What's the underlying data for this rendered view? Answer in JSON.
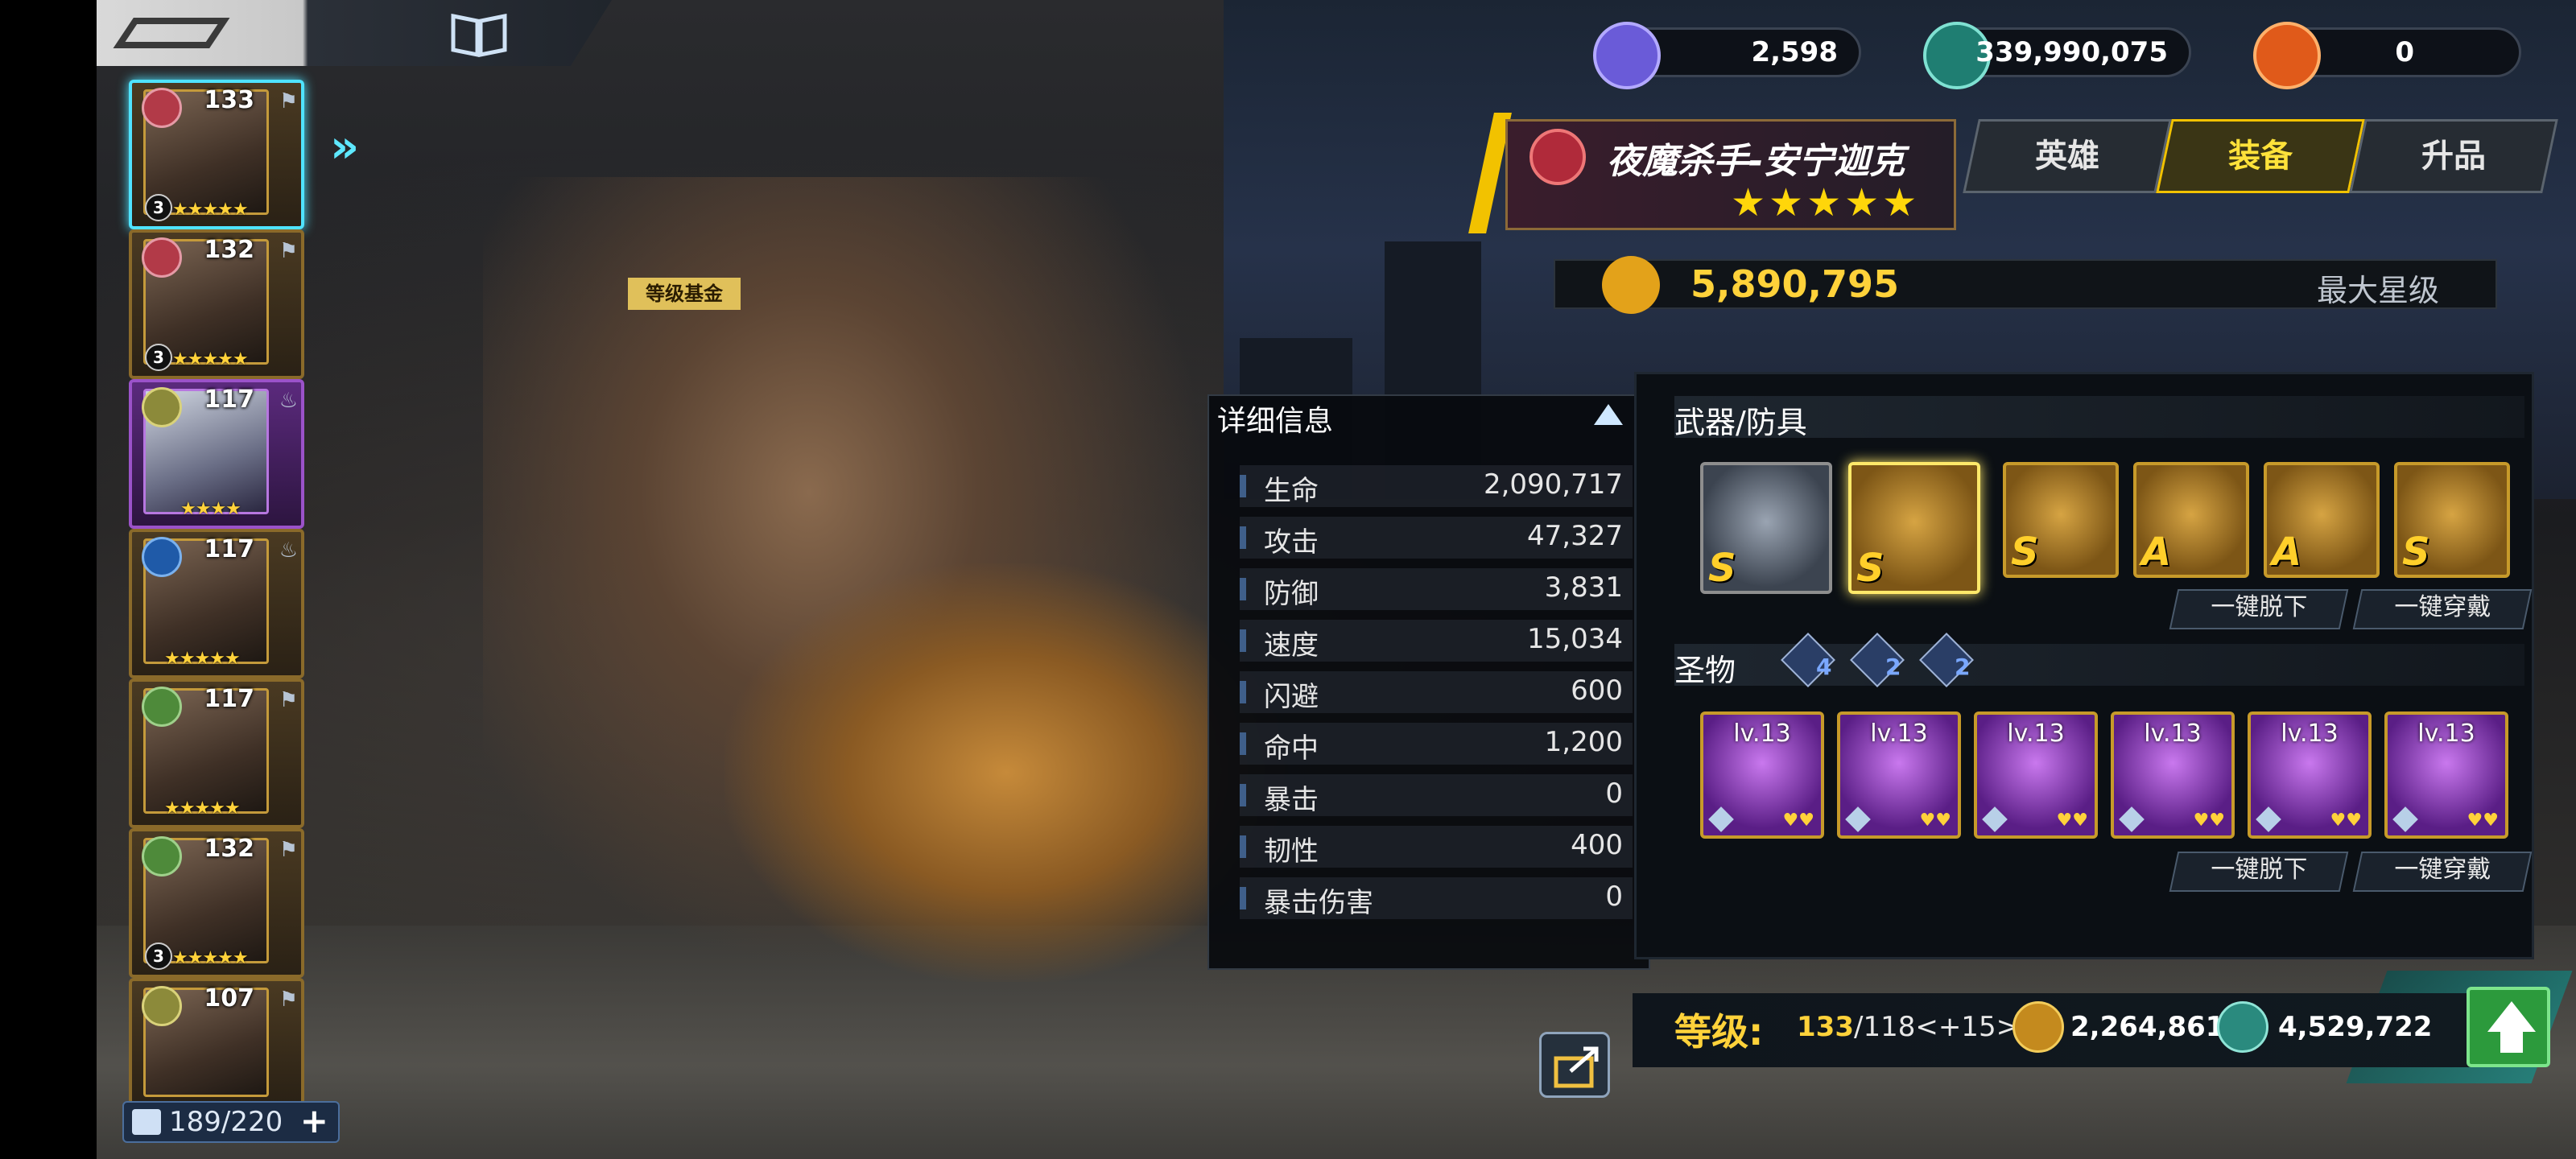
{
  "currency": {
    "gems": "2,598",
    "credits": "339,990,075",
    "orbs": "0"
  },
  "hero": {
    "name": "夜魔杀手-安宁迦克",
    "stars": "★★★★★",
    "power": "5,890,795",
    "max_star_label": "最大星级"
  },
  "tabs": [
    "英雄",
    "装备",
    "升品"
  ],
  "hero_list": [
    {
      "level": "133",
      "rank": "3",
      "stars": "★★★★★"
    },
    {
      "level": "132",
      "rank": "3",
      "stars": "★★★★★"
    },
    {
      "level": "117",
      "rank": "",
      "stars": "★★★★"
    },
    {
      "level": "117",
      "rank": "",
      "stars": "★★★★★"
    },
    {
      "level": "117",
      "rank": "",
      "stars": "★★★★★"
    },
    {
      "level": "132",
      "rank": "3",
      "stars": "★★★★★"
    },
    {
      "level": "107",
      "rank": "",
      "stars": ""
    }
  ],
  "slots": "189/220",
  "sign_text": "等级基金",
  "details": {
    "title": "详细信息",
    "stats": [
      {
        "label": "生命",
        "value": "2,090,717"
      },
      {
        "label": "攻击",
        "value": "47,327"
      },
      {
        "label": "防御",
        "value": "3,831"
      },
      {
        "label": "速度",
        "value": "15,034"
      },
      {
        "label": "闪避",
        "value": "600"
      },
      {
        "label": "命中",
        "value": "1,200"
      },
      {
        "label": "暴击",
        "value": "0"
      },
      {
        "label": "韧性",
        "value": "400"
      },
      {
        "label": "暴击伤害",
        "value": "0"
      }
    ]
  },
  "equipment": {
    "section_title": "武器/防具",
    "items": [
      {
        "grade": "S"
      },
      {
        "grade": "S"
      },
      {
        "grade": "S"
      },
      {
        "grade": "A"
      },
      {
        "grade": "A"
      },
      {
        "grade": "S"
      }
    ],
    "unequip_all": "一键脱下",
    "equip_all": "一键穿戴"
  },
  "relics": {
    "section_title": "圣物",
    "set_counts": [
      "4",
      "2",
      "2"
    ],
    "items": [
      {
        "level": "lv.13",
        "hearts": "♥♥"
      },
      {
        "level": "lv.13",
        "hearts": "♥♥"
      },
      {
        "level": "lv.13",
        "hearts": "♥♥"
      },
      {
        "level": "lv.13",
        "hearts": "♥♥"
      },
      {
        "level": "lv.13",
        "hearts": "♥♥"
      },
      {
        "level": "lv.13",
        "hearts": "♥♥"
      }
    ],
    "unequip_all": "一键脱下",
    "equip_all": "一键穿戴"
  },
  "level_bar": {
    "label": "等级:",
    "current": "133",
    "rest": "/118<+15>",
    "gold_cost": "2,264,861",
    "credit_cost": "4,529,722"
  },
  "colors": {
    "accent_yellow": "#f2c200",
    "selected_cyan": "#4fe3ff",
    "upgrade_green": "#2c9a3c"
  }
}
